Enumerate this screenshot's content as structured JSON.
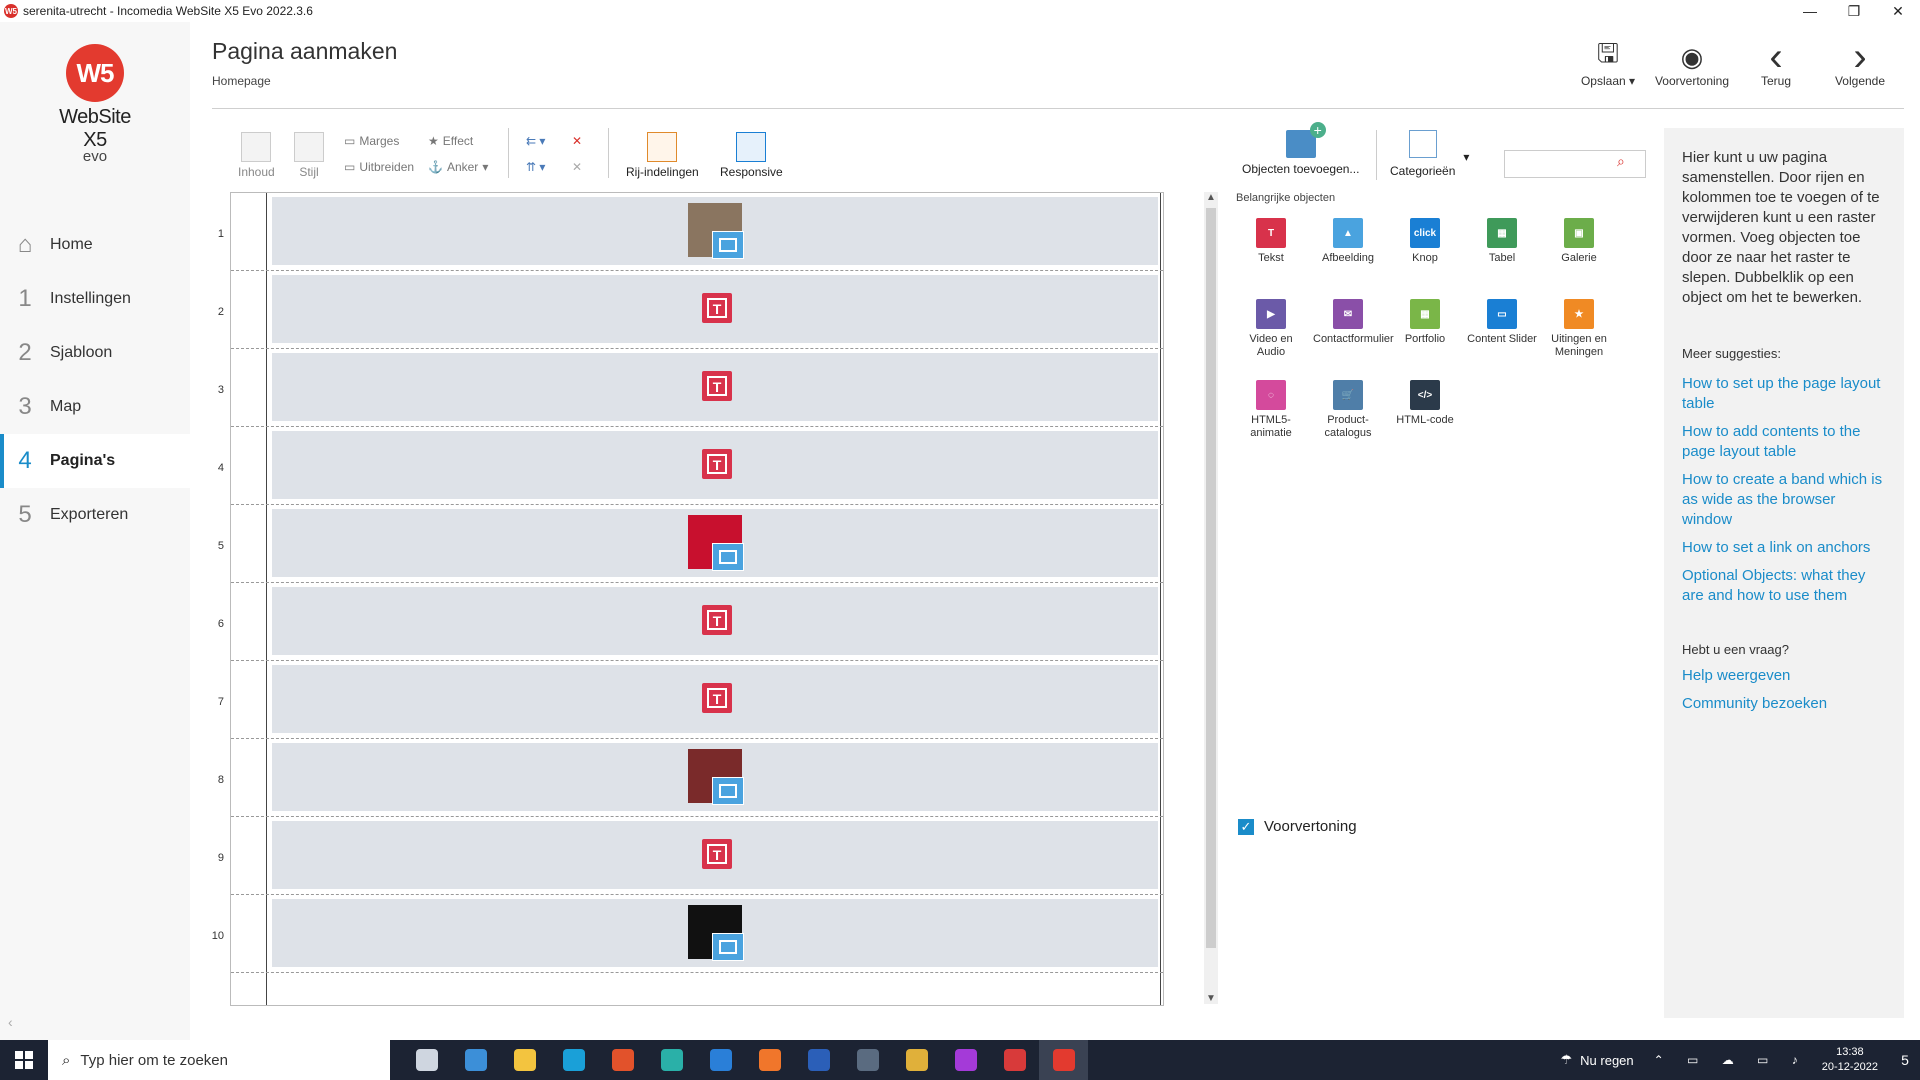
{
  "window": {
    "title": "serenita-utrecht - Incomedia WebSite X5 Evo 2022.3.6",
    "icon_label": "W5"
  },
  "logo": {
    "badge": "W5",
    "brand": "WebSite X5",
    "edition": "evo"
  },
  "nav": [
    {
      "num": "",
      "label": "Home",
      "icon": "home-icon"
    },
    {
      "num": "1",
      "label": "Instellingen"
    },
    {
      "num": "2",
      "label": "Sjabloon"
    },
    {
      "num": "3",
      "label": "Map"
    },
    {
      "num": "4",
      "label": "Pagina's",
      "active": true
    },
    {
      "num": "5",
      "label": "Exporteren"
    }
  ],
  "header": {
    "title": "Pagina aanmaken",
    "subtitle": "Homepage",
    "actions": [
      {
        "label": "Opslaan ▾",
        "icon": "save-icon"
      },
      {
        "label": "Voorvertoning",
        "icon": "eye-icon"
      },
      {
        "label": "Terug",
        "icon": "chevron-left-icon"
      },
      {
        "label": "Volgende",
        "icon": "chevron-right-icon"
      }
    ]
  },
  "toolbar": {
    "inhoud": "Inhoud",
    "stijl": "Stijl",
    "marges": "Marges",
    "uitbreiden": "Uitbreiden",
    "effect": "Effect",
    "anker": "Anker",
    "rij_indelingen": "Rij-indelingen",
    "responsive": "Responsive",
    "objecten_toevoegen": "Objecten toevoegen...",
    "categorieen": "Categorieën",
    "search_placeholder": ""
  },
  "grid": {
    "rows": [
      {
        "n": "1",
        "object": "image",
        "photo_color": "#8a7560"
      },
      {
        "n": "2",
        "object": "text"
      },
      {
        "n": "3",
        "object": "text"
      },
      {
        "n": "4",
        "object": "text"
      },
      {
        "n": "5",
        "object": "image",
        "photo_color": "#c8102e"
      },
      {
        "n": "6",
        "object": "text"
      },
      {
        "n": "7",
        "object": "text"
      },
      {
        "n": "8",
        "object": "image",
        "photo_color": "#7a2a2a"
      },
      {
        "n": "9",
        "object": "text"
      },
      {
        "n": "10",
        "object": "image",
        "photo_color": "#111111"
      }
    ]
  },
  "objects": {
    "title": "Belangrijke objecten",
    "items": [
      {
        "label": "Tekst",
        "icon": "text-object-icon",
        "color": "#d8324b",
        "glyph": "T"
      },
      {
        "label": "Afbeelding",
        "icon": "image-object-icon",
        "color": "#4aa3df",
        "glyph": "▲"
      },
      {
        "label": "Knop",
        "icon": "button-object-icon",
        "color": "#1a7fd4",
        "glyph": "click"
      },
      {
        "label": "Tabel",
        "icon": "table-object-icon",
        "color": "#3f9a5a",
        "glyph": "▦"
      },
      {
        "label": "Galerie",
        "icon": "gallery-object-icon",
        "color": "#6cad4a",
        "glyph": "▣"
      },
      {
        "label": "Video en Audio",
        "icon": "video-audio-object-icon",
        "color": "#6b5aa8",
        "glyph": "▶"
      },
      {
        "label": "Contactformulier",
        "icon": "contact-form-object-icon",
        "color": "#8a4fa8",
        "glyph": "✉"
      },
      {
        "label": "Portfolio",
        "icon": "portfolio-object-icon",
        "color": "#7ab648",
        "glyph": "▦"
      },
      {
        "label": "Content Slider",
        "icon": "content-slider-object-icon",
        "color": "#1a7fd4",
        "glyph": "▭"
      },
      {
        "label": "Uitingen en Meningen",
        "icon": "comments-object-icon",
        "color": "#f08a24",
        "glyph": "★"
      },
      {
        "label": "HTML5-animatie",
        "icon": "html5-animation-object-icon",
        "color": "#d44a9c",
        "glyph": "◌"
      },
      {
        "label": "Product-catalogus",
        "icon": "product-catalog-object-icon",
        "color": "#4f7ea8",
        "glyph": "🛒"
      },
      {
        "label": "HTML-code",
        "icon": "html-code-object-icon",
        "color": "#2b3a4a",
        "glyph": "</>"
      }
    ],
    "preview_label": "Voorvertoning"
  },
  "help": {
    "intro": "Hier kunt u uw pagina samenstellen. Door rijen en kolommen toe te voegen of te verwijderen kunt u een raster vormen. Voeg objecten toe door ze naar het raster te slepen. Dubbelklik op een object om het te bewerken.",
    "more_title": "Meer suggesties:",
    "links": [
      "How to set up the page layout table",
      "How to add contents to the page layout table",
      "How to create a band which is as wide as the browser window",
      "How to set a link on anchors",
      "Optional Objects: what they are and how to use them"
    ],
    "question_title": "Hebt u een vraag?",
    "help_links": [
      "Help weergeven",
      "Community bezoeken"
    ]
  },
  "taskbar": {
    "search_placeholder": "Typ hier om te zoeken",
    "apps": [
      {
        "name": "task-view-icon",
        "color": "#cfd6e0"
      },
      {
        "name": "store-icon",
        "color": "#3c8fd8"
      },
      {
        "name": "file-explorer-icon",
        "color": "#f3c43f"
      },
      {
        "name": "cortana-icon",
        "color": "#1aa0d8"
      },
      {
        "name": "office-icon",
        "color": "#e2522b"
      },
      {
        "name": "edge-icon",
        "color": "#2ab0a8"
      },
      {
        "name": "mail-icon",
        "color": "#2a7fd8"
      },
      {
        "name": "firefox-icon",
        "color": "#f0762b"
      },
      {
        "name": "word-icon",
        "color": "#2b5fb8"
      },
      {
        "name": "calculator-icon",
        "color": "#5a6b80"
      },
      {
        "name": "app-icon",
        "color": "#e0b03a"
      },
      {
        "name": "app-icon",
        "color": "#a43ad8"
      },
      {
        "name": "app-icon",
        "color": "#d83a3a"
      },
      {
        "name": "website-x5-icon",
        "color": "#e33a2f"
      }
    ],
    "weather": "Nu regen",
    "time": "13:38",
    "date": "20-12-2022",
    "notifications": "5"
  }
}
